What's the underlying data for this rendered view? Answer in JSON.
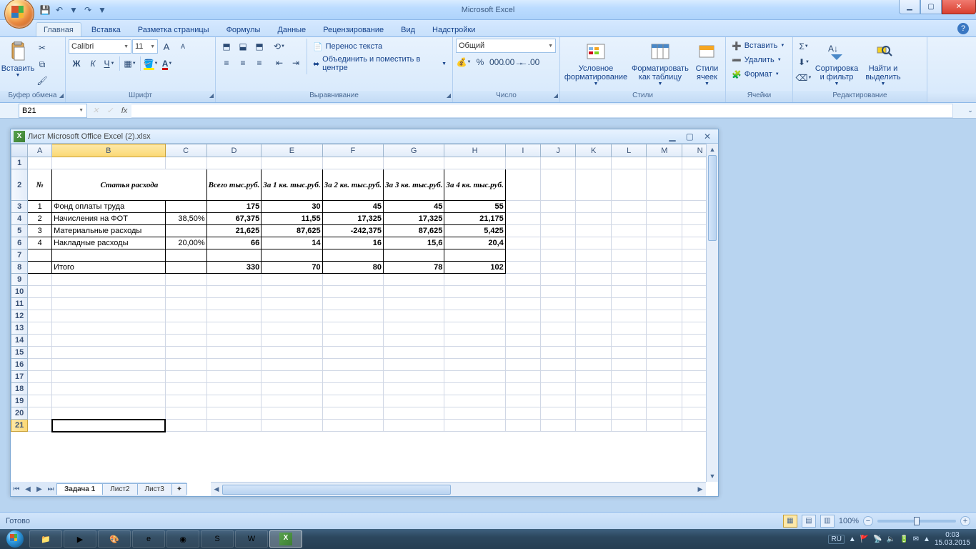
{
  "app_title": "Microsoft Excel",
  "doc_title": "Лист Microsoft Office Excel (2).xlsx",
  "qat": {
    "save": "💾",
    "undo": "↶",
    "redo": "↷",
    "down": "▾"
  },
  "tabs": [
    "Главная",
    "Вставка",
    "Разметка страницы",
    "Формулы",
    "Данные",
    "Рецензирование",
    "Вид",
    "Надстройки"
  ],
  "ribbon": {
    "clipboard": {
      "paste": "Вставить",
      "label": "Буфер обмена"
    },
    "font": {
      "name": "Calibri",
      "size": "11",
      "label": "Шрифт"
    },
    "align": {
      "wrap": "Перенос текста",
      "merge": "Объединить и поместить в центре",
      "label": "Выравнивание"
    },
    "number": {
      "format": "Общий",
      "label": "Число"
    },
    "styles": {
      "cond": "Условное форматирование",
      "table": "Форматировать как таблицу",
      "cell": "Стили ячеек",
      "label": "Стили"
    },
    "cells": {
      "insert": "Вставить",
      "delete": "Удалить",
      "format": "Формат",
      "label": "Ячейки"
    },
    "editing": {
      "sort": "Сортировка и фильтр",
      "find": "Найти и выделить",
      "label": "Редактирование"
    }
  },
  "namebox": "B21",
  "columns": [
    "A",
    "B",
    "C",
    "D",
    "E",
    "F",
    "G",
    "H",
    "I",
    "J",
    "K",
    "L",
    "M",
    "N"
  ],
  "table": {
    "headers": {
      "num": "№",
      "article": "Статья расхода",
      "total": "Всего тыс.руб.",
      "q1": "За 1 кв. тыс.руб.",
      "q2": "За 2 кв. тыс.руб.",
      "q3": "За 3 кв. тыс.руб.",
      "q4": "За 4 кв. тыс.руб."
    },
    "rows": [
      {
        "n": "1",
        "name": "Фонд оплаты труда",
        "c": "",
        "d": "175",
        "e": "30",
        "f": "45",
        "g": "45",
        "h": "55"
      },
      {
        "n": "2",
        "name": "Начисления на ФОТ",
        "c": "38,50%",
        "d": "67,375",
        "e": "11,55",
        "f": "17,325",
        "g": "17,325",
        "h": "21,175"
      },
      {
        "n": "3",
        "name": "Материальные расходы",
        "c": "",
        "d": "21,625",
        "e": "87,625",
        "f": "-242,375",
        "g": "87,625",
        "h": "5,425"
      },
      {
        "n": "4",
        "name": "Накладные расходы",
        "c": "20,00%",
        "d": "66",
        "e": "14",
        "f": "16",
        "g": "15,6",
        "h": "20,4"
      }
    ],
    "total": {
      "name": "Итого",
      "d": "330",
      "e": "70",
      "f": "80",
      "g": "78",
      "h": "102"
    }
  },
  "sheets": [
    "Задача 1",
    "Лист2",
    "Лист3"
  ],
  "status": {
    "ready": "Готово",
    "zoom": "100%"
  },
  "tray": {
    "lang": "RU",
    "time": "0:03",
    "date": "15.03.2015"
  }
}
